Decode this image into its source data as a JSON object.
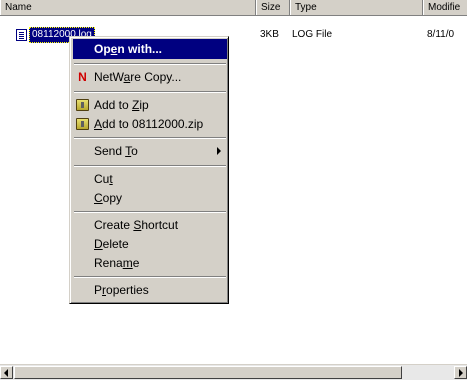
{
  "columns": {
    "name": "Name",
    "size": "Size",
    "type": "Type",
    "modified": "Modifie"
  },
  "file": {
    "name": "08112000.log",
    "size": "3KB",
    "type": "LOG File",
    "modified": "8/11/0"
  },
  "menu": {
    "open_with": [
      "Op",
      "e",
      "n with..."
    ],
    "netware_copy": [
      "NetW",
      "a",
      "re Copy..."
    ],
    "add_to_zip": [
      "Add to ",
      "Z",
      "ip"
    ],
    "add_to_named_zip": [
      "",
      "A",
      "dd to 08112000.zip"
    ],
    "send_to": [
      "Send ",
      "T",
      "o"
    ],
    "cut": [
      "Cu",
      "t",
      ""
    ],
    "copy": [
      "",
      "C",
      "opy"
    ],
    "create_shortcut": [
      "Create ",
      "S",
      "hortcut"
    ],
    "delete": [
      "",
      "D",
      "elete"
    ],
    "rename": [
      "Rena",
      "m",
      "e"
    ],
    "properties": [
      "P",
      "r",
      "operties"
    ]
  },
  "icons": {
    "netware": "N",
    "file": "log-file-icon",
    "zip": "winzip-icon"
  }
}
